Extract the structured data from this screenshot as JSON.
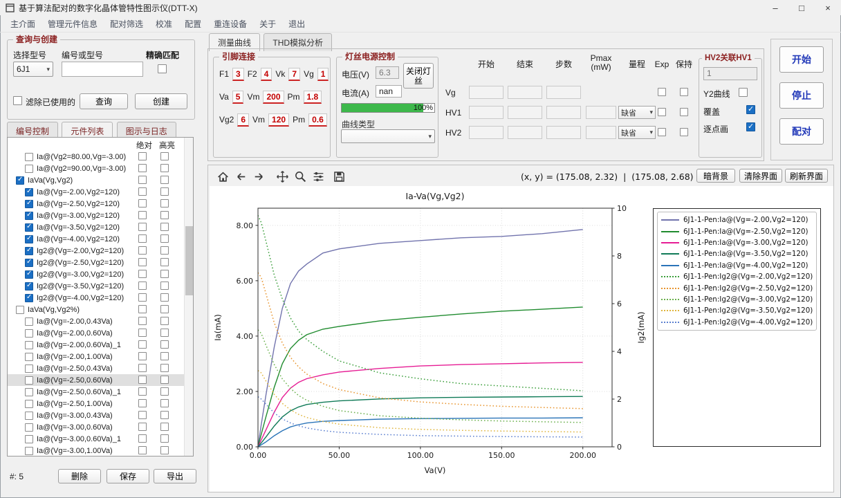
{
  "window": {
    "title": "基于算法配对的数字化晶体管特性图示仪(DTT-X)",
    "minimize": "–",
    "maximize": "□",
    "close": "×"
  },
  "menu": {
    "items": [
      "主介面",
      "管理元件信息",
      "配对筛选",
      "校准",
      "配置",
      "重连设备",
      "关于",
      "退出"
    ]
  },
  "left_panel": {
    "query_group": {
      "title": "查询与创建",
      "model_label": "选择型号",
      "model_value": "6J1",
      "code_label": "编号或型号",
      "exact_label": "精确匹配",
      "filter_used_label": "滤除已使用的",
      "query_button": "查询",
      "create_button": "创建"
    },
    "tabs": [
      "编号控制",
      "元件列表",
      "图示与日志"
    ],
    "list": {
      "col_absolute": "绝对",
      "col_highlight": "高亮",
      "items": [
        {
          "label": "Ia@(Vg2=80.00,Vg=-3.00)",
          "checked": false,
          "indent": 1
        },
        {
          "label": "Ia@(Vg2=90.00,Vg=-3.00)",
          "checked": false,
          "indent": 1
        },
        {
          "label": "IaVa(Vg,Vg2)",
          "checked": true,
          "indent": 0
        },
        {
          "label": "Ia@(Vg=-2.00,Vg2=120)",
          "checked": true,
          "indent": 1
        },
        {
          "label": "Ia@(Vg=-2.50,Vg2=120)",
          "checked": true,
          "indent": 1
        },
        {
          "label": "Ia@(Vg=-3.00,Vg2=120)",
          "checked": true,
          "indent": 1
        },
        {
          "label": "Ia@(Vg=-3.50,Vg2=120)",
          "checked": true,
          "indent": 1
        },
        {
          "label": "Ia@(Vg=-4.00,Vg2=120)",
          "checked": true,
          "indent": 1
        },
        {
          "label": "Ig2@(Vg=-2.00,Vg2=120)",
          "checked": true,
          "indent": 1
        },
        {
          "label": "Ig2@(Vg=-2.50,Vg2=120)",
          "checked": true,
          "indent": 1
        },
        {
          "label": "Ig2@(Vg=-3.00,Vg2=120)",
          "checked": true,
          "indent": 1
        },
        {
          "label": "Ig2@(Vg=-3.50,Vg2=120)",
          "checked": true,
          "indent": 1
        },
        {
          "label": "Ig2@(Vg=-4.00,Vg2=120)",
          "checked": true,
          "indent": 1
        },
        {
          "label": "IaVa(Vg,Vg2%)",
          "checked": false,
          "indent": 0
        },
        {
          "label": "Ia@(Vg=-2.00,0.43Va)",
          "checked": false,
          "indent": 1
        },
        {
          "label": "Ia@(Vg=-2.00,0.60Va)",
          "checked": false,
          "indent": 1
        },
        {
          "label": "Ia@(Vg=-2.00,0.60Va)_1",
          "checked": false,
          "indent": 1
        },
        {
          "label": "Ia@(Vg=-2.00,1.00Va)",
          "checked": false,
          "indent": 1
        },
        {
          "label": "Ia@(Vg=-2.50,0.43Va)",
          "checked": false,
          "indent": 1
        },
        {
          "label": "Ia@(Vg=-2.50,0.60Va)",
          "checked": false,
          "indent": 1,
          "selected": true
        },
        {
          "label": "Ia@(Vg=-2.50,0.60Va)_1",
          "checked": false,
          "indent": 1
        },
        {
          "label": "Ia@(Vg=-2.50,1.00Va)",
          "checked": false,
          "indent": 1
        },
        {
          "label": "Ia@(Vg=-3.00,0.43Va)",
          "checked": false,
          "indent": 1
        },
        {
          "label": "Ia@(Vg=-3.00,0.60Va)",
          "checked": false,
          "indent": 1
        },
        {
          "label": "Ia@(Vg=-3.00,0.60Va)_1",
          "checked": false,
          "indent": 1
        },
        {
          "label": "Ia@(Vg=-3.00,1.00Va)",
          "checked": false,
          "indent": 1
        }
      ]
    },
    "footer": {
      "count_label": "#: 5",
      "delete_button": "删除",
      "save_button": "保存",
      "export_button": "导出"
    }
  },
  "measure_panel": {
    "tabs": [
      "测量曲线",
      "THD模拟分析"
    ],
    "pin_group": {
      "title": "引脚连接",
      "rows": [
        [
          {
            "label": "F1",
            "value": "3"
          },
          {
            "label": "F2",
            "value": "4"
          },
          {
            "label": "Vk",
            "value": "7"
          },
          {
            "label": "Vg",
            "value": "1"
          }
        ],
        [
          {
            "label": "Va",
            "value": "5"
          },
          {
            "label": "Vm",
            "value": "200"
          },
          {
            "label": "Pm",
            "value": "1.8"
          }
        ],
        [
          {
            "label": "Vg2",
            "value": "6"
          },
          {
            "label": "Vm",
            "value": "120"
          },
          {
            "label": "Pm",
            "value": "0.6"
          }
        ]
      ]
    },
    "filament_group": {
      "title": "灯丝电源控制",
      "voltage_label": "电压(V)",
      "voltage_value": "6.3",
      "off_button": "关闭灯丝",
      "current_label": "电流(A)",
      "current_value": "nan",
      "progress_text": "100%",
      "curve_type_label": "曲线类型"
    },
    "sweep_table": {
      "headers": [
        "开始",
        "结束",
        "步数",
        "Pmax\n(mW)",
        "量程",
        "Exp",
        "保持"
      ],
      "rows": [
        {
          "name": "Vg",
          "start": "",
          "end": "",
          "steps": "",
          "pmax": null,
          "range": null,
          "exp": false,
          "hold": false
        },
        {
          "name": "HV1",
          "start": "",
          "end": "",
          "steps": "",
          "pmax": "",
          "range": "缺省",
          "exp": false,
          "hold": false
        },
        {
          "name": "HV2",
          "start": "",
          "end": "",
          "steps": "",
          "pmax": "",
          "range": "缺省",
          "exp": false,
          "hold": false
        }
      ]
    },
    "hv2_group": {
      "title": "HV2关联HV1",
      "ratio_value": "1",
      "y2_label": "Y2曲线",
      "y2_checked": false,
      "overlay_label": "覆盖",
      "overlay_checked": true,
      "pointwise_label": "逐点画",
      "pointwise_checked": true
    },
    "action_buttons": {
      "start": "开始",
      "stop": "停止",
      "pair": "配对"
    }
  },
  "plot": {
    "toolbar": {
      "icons": [
        "home",
        "back",
        "forward",
        "pan",
        "zoom",
        "configure",
        "save"
      ],
      "coords": "(x, y) = (175.08, 2.32)  |  (175.08, 2.68)",
      "dark_bg_button": "暗背景",
      "clear_button": "清除界面",
      "refresh_button": "刷新界面"
    }
  },
  "chart_data": {
    "type": "line",
    "title": "Ia-Va(Vg,Vg2)",
    "xlabel": "Va(V)",
    "ylabel_left": "Ia(mA)",
    "ylabel_right": "Ig2(mA)",
    "xlim": [
      0,
      218
    ],
    "ylim_left": [
      0,
      8.62
    ],
    "ylim_right": [
      0,
      10
    ],
    "grid": true,
    "legend_position": "right-outside",
    "xticks": {
      "values": [
        0,
        50,
        100,
        150,
        200
      ],
      "labels": [
        "0.00",
        "50.00",
        "100.00",
        "150.00",
        "200.00"
      ]
    },
    "yticks_left": {
      "values": [
        0,
        2,
        4,
        6,
        8
      ],
      "labels": [
        "0.00",
        "2.00",
        "4.00",
        "6.00",
        "8.00"
      ]
    },
    "yticks_right": {
      "values": [
        0,
        2,
        4,
        6,
        8,
        10
      ],
      "labels": [
        "0",
        "2",
        "4",
        "6",
        "8",
        "10"
      ]
    },
    "x": [
      0,
      2,
      5,
      10,
      15,
      20,
      25,
      30,
      40,
      50,
      75,
      100,
      125,
      150,
      175,
      200
    ],
    "series": [
      {
        "name": "6J1-1-Pen:Ia@(Vg=-2.00,Vg2=120)",
        "axis": "left",
        "line": "solid",
        "color": "#7173ad",
        "values": [
          0,
          0.8,
          1.9,
          3.6,
          5.0,
          5.9,
          6.35,
          6.6,
          7.0,
          7.15,
          7.35,
          7.45,
          7.55,
          7.6,
          7.7,
          7.85
        ]
      },
      {
        "name": "6J1-1-Pen:Ia@(Vg=-2.50,Vg2=120)",
        "axis": "left",
        "line": "solid",
        "color": "#1f8b2e",
        "values": [
          0,
          0.45,
          1.1,
          2.15,
          3.0,
          3.55,
          3.85,
          4.05,
          4.25,
          4.35,
          4.55,
          4.68,
          4.8,
          4.9,
          4.97,
          5.05
        ]
      },
      {
        "name": "6J1-1-Pen:Ia@(Vg=-3.00,Vg2=120)",
        "axis": "left",
        "line": "solid",
        "color": "#e61c94",
        "values": [
          0,
          0.25,
          0.62,
          1.25,
          1.78,
          2.12,
          2.33,
          2.46,
          2.6,
          2.7,
          2.83,
          2.92,
          2.97,
          3.0,
          3.03,
          3.05
        ]
      },
      {
        "name": "6J1-1-Pen:Ia@(Vg=-3.50,Vg2=120)",
        "axis": "left",
        "line": "solid",
        "color": "#0f7a57",
        "values": [
          0,
          0.14,
          0.36,
          0.75,
          1.08,
          1.3,
          1.44,
          1.53,
          1.61,
          1.66,
          1.73,
          1.77,
          1.79,
          1.8,
          1.81,
          1.82
        ]
      },
      {
        "name": "6J1-1-Pen:Ia@(Vg=-4.00,Vg2=120)",
        "axis": "left",
        "line": "solid",
        "color": "#2a74b8",
        "values": [
          0,
          0.07,
          0.18,
          0.4,
          0.58,
          0.72,
          0.8,
          0.86,
          0.92,
          0.95,
          1.0,
          1.02,
          1.03,
          1.04,
          1.04,
          1.05
        ]
      },
      {
        "name": "6J1-1-Pen:Ig2@(Vg=-2.00,Vg2=120)",
        "axis": "right",
        "line": "dotted",
        "color": "#3a9e3a",
        "values": [
          9.7,
          9.4,
          8.6,
          7.2,
          6.2,
          5.4,
          4.85,
          4.5,
          4.0,
          3.6,
          3.1,
          2.85,
          2.65,
          2.55,
          2.45,
          2.35
        ]
      },
      {
        "name": "6J1-1-Pen:Ig2@(Vg=-2.50,Vg2=120)",
        "axis": "right",
        "line": "dotted",
        "color": "#e8952e",
        "values": [
          7.3,
          7.1,
          6.4,
          5.2,
          4.35,
          3.75,
          3.35,
          3.05,
          2.65,
          2.4,
          2.05,
          1.88,
          1.78,
          1.7,
          1.65,
          1.6
        ]
      },
      {
        "name": "6J1-1-Pen:Ig2@(Vg=-3.00,Vg2=120)",
        "axis": "right",
        "line": "dotted",
        "color": "#6ab04c",
        "values": [
          4.9,
          4.75,
          4.25,
          3.45,
          2.85,
          2.45,
          2.15,
          1.95,
          1.7,
          1.52,
          1.3,
          1.2,
          1.13,
          1.08,
          1.05,
          1.02
        ]
      },
      {
        "name": "6J1-1-Pen:Ig2@(Vg=-3.50,Vg2=120)",
        "axis": "right",
        "line": "dotted",
        "color": "#e0b53c",
        "values": [
          3.2,
          3.1,
          2.75,
          2.2,
          1.82,
          1.55,
          1.36,
          1.23,
          1.06,
          0.95,
          0.8,
          0.73,
          0.69,
          0.66,
          0.64,
          0.62
        ]
      },
      {
        "name": "6J1-1-Pen:Ig2@(Vg=-4.00,Vg2=120)",
        "axis": "right",
        "line": "dotted",
        "color": "#5b7fd0",
        "values": [
          2.1,
          2.0,
          1.78,
          1.42,
          1.17,
          1.0,
          0.88,
          0.79,
          0.68,
          0.61,
          0.52,
          0.47,
          0.45,
          0.43,
          0.42,
          0.41
        ]
      }
    ]
  }
}
